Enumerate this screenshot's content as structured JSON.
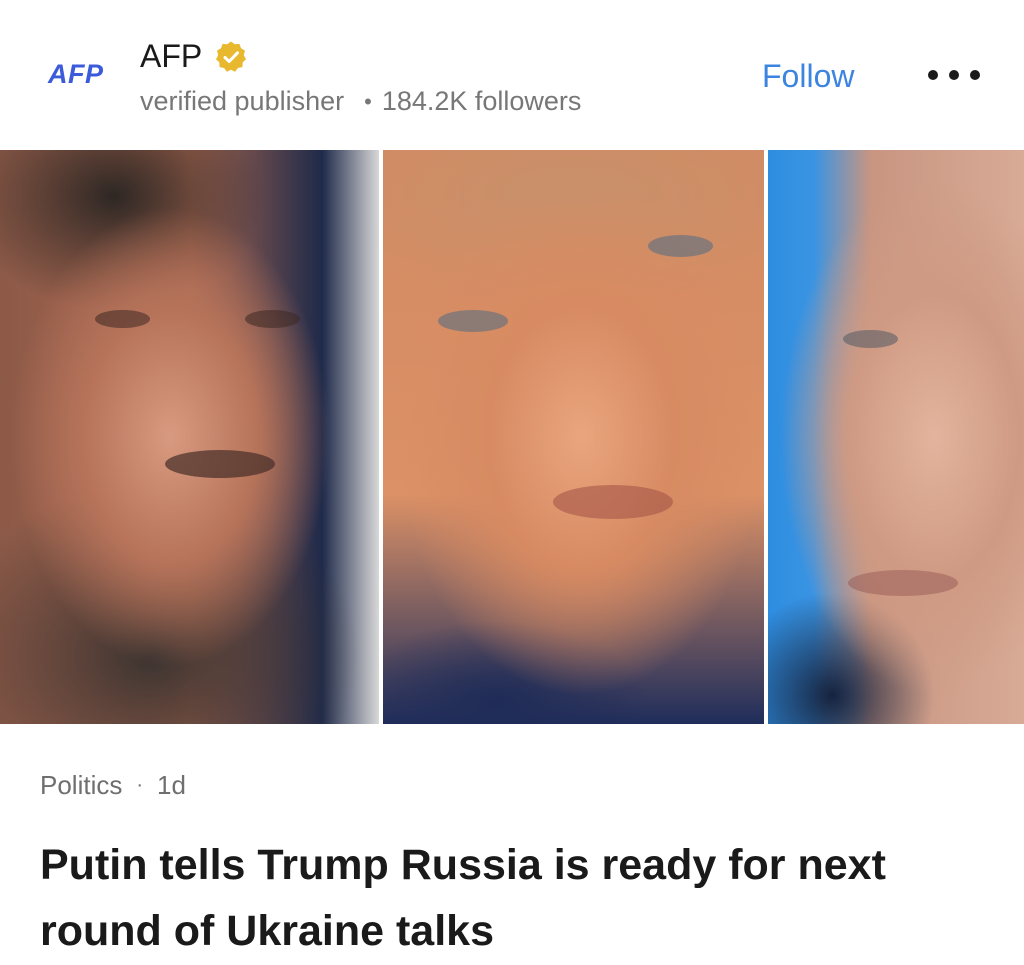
{
  "publisher": {
    "logo_text": "AFP",
    "name": "AFP",
    "verified_label": "verified publisher",
    "separator": "•",
    "followers": "184.2K followers",
    "verified_icon": "verified-badge-icon",
    "accent_color": "#3b5bdb",
    "badge_color": "#e8b92f"
  },
  "actions": {
    "follow_label": "Follow",
    "follow_color": "#3d84e0",
    "more_icon": "more-dots-icon"
  },
  "article": {
    "category": "Politics",
    "separator": "·",
    "age": "1d",
    "headline": "Putin tells Trump Russia is ready for next round of Ukraine talks"
  }
}
